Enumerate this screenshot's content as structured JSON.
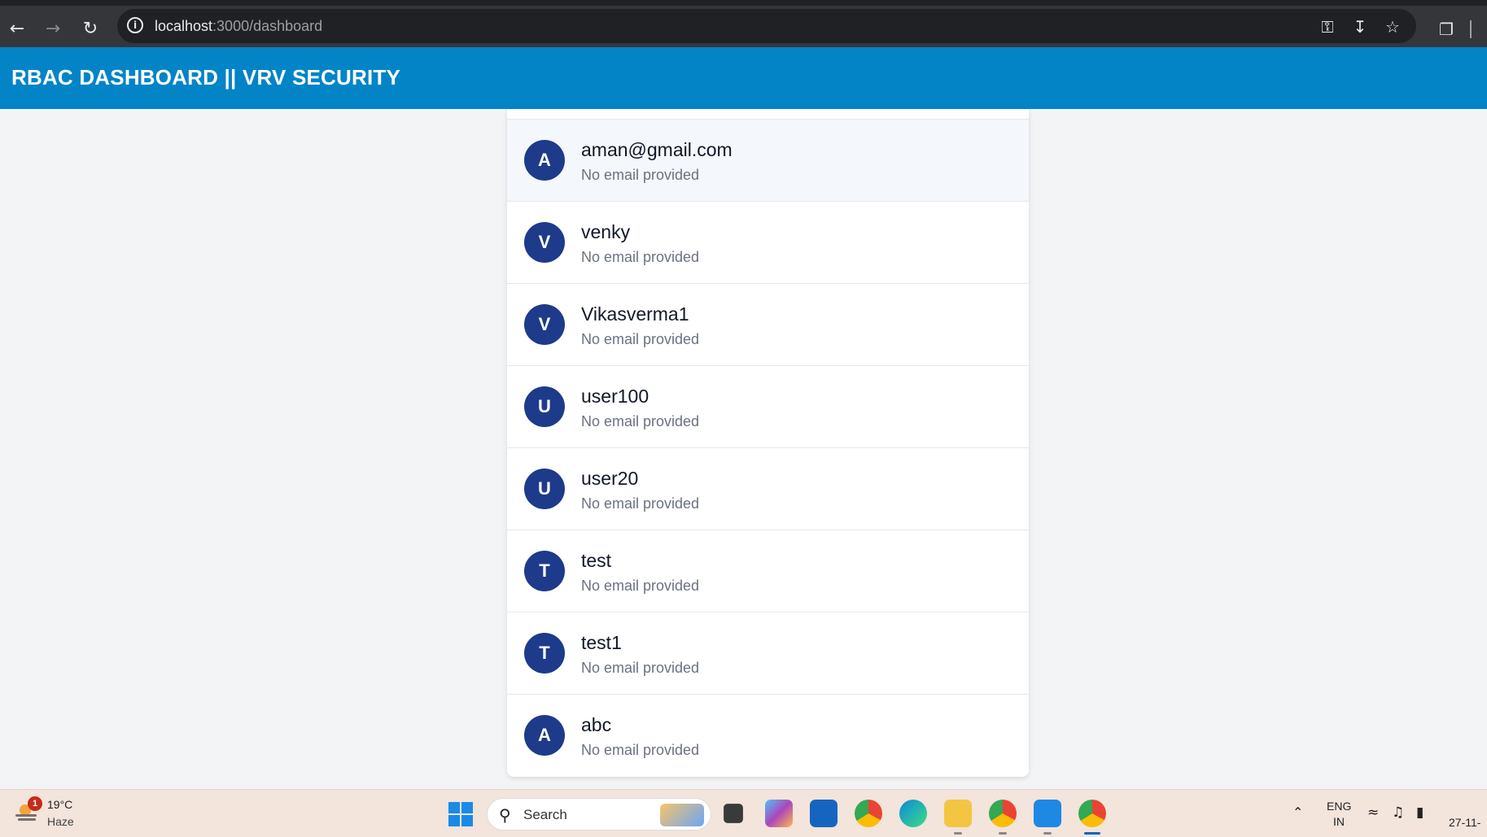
{
  "browser": {
    "url_host": "localhost",
    "url_path": ":3000/dashboard",
    "icons": [
      "back-icon",
      "forward-icon",
      "reload-icon",
      "site-info-icon",
      "password-key-icon",
      "install-app-icon",
      "bookmark-star-icon",
      "extensions-icon"
    ]
  },
  "header": {
    "title": "RBAC DASHBOARD || VRV SECURITY",
    "color": "#0284c7"
  },
  "users": [
    {
      "initial": "A",
      "name": "aman@gmail.com",
      "email": "No email provided"
    },
    {
      "initial": "V",
      "name": "venky",
      "email": "No email provided"
    },
    {
      "initial": "V",
      "name": "Vikasverma1",
      "email": "No email provided"
    },
    {
      "initial": "U",
      "name": "user100",
      "email": "No email provided"
    },
    {
      "initial": "U",
      "name": "user20",
      "email": "No email provided"
    },
    {
      "initial": "T",
      "name": "test",
      "email": "No email provided"
    },
    {
      "initial": "T",
      "name": "test1",
      "email": "No email provided"
    },
    {
      "initial": "A",
      "name": "abc",
      "email": "No email provided"
    }
  ],
  "avatar_color": "#1e3a8a",
  "taskbar": {
    "weather_temp": "19°C",
    "weather_condition": "Haze",
    "weather_badge": "1",
    "search_label": "Search",
    "lang_line1": "ENG",
    "lang_line2": "IN",
    "date": "27-11-",
    "apps": [
      "task-view-icon",
      "copilot-icon",
      "store-icon",
      "chrome-icon",
      "edge-icon",
      "file-explorer-icon",
      "chrome-profile-icon",
      "vscode-icon",
      "chrome-active-icon"
    ]
  }
}
